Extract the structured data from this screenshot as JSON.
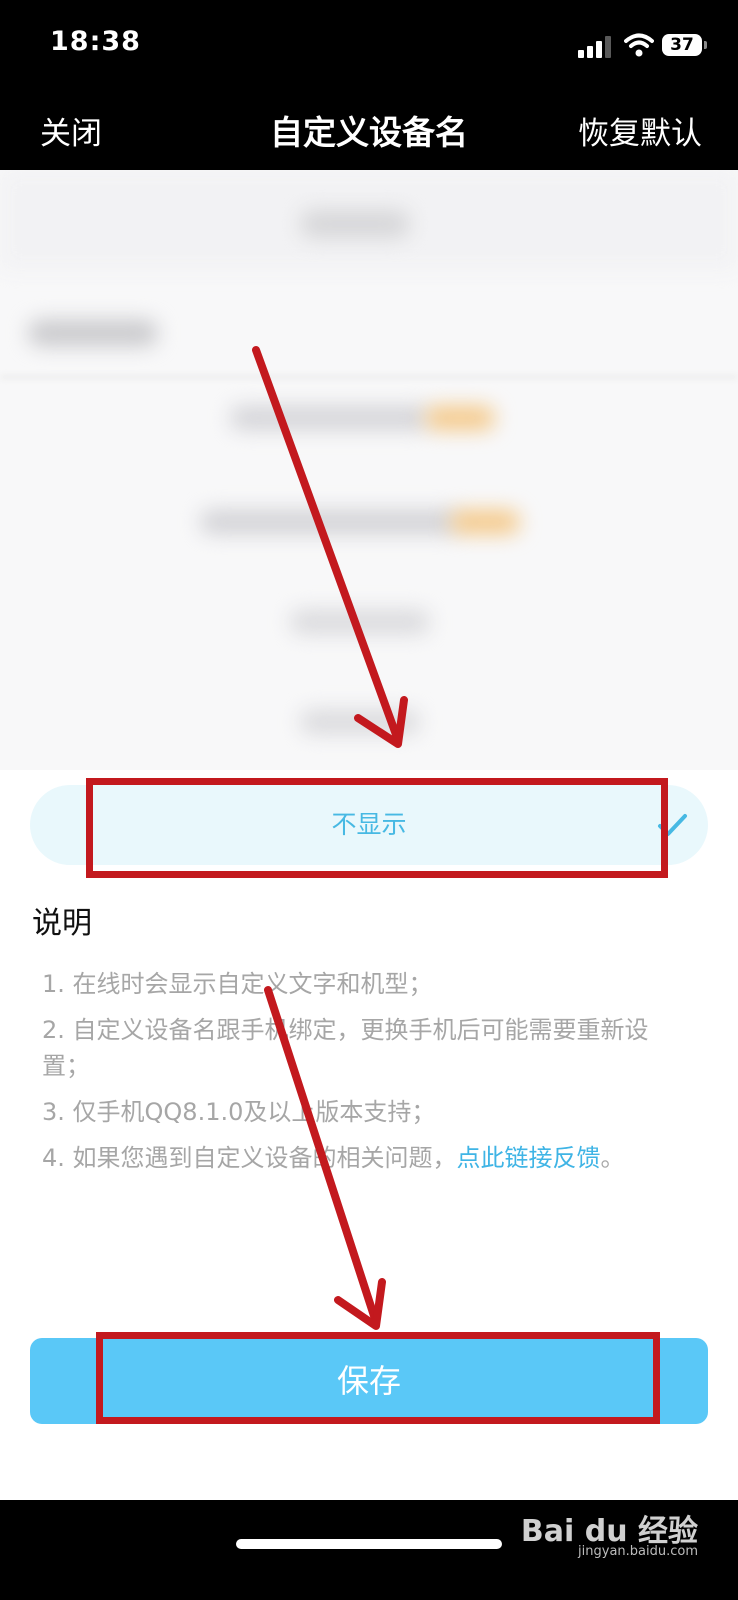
{
  "status_bar": {
    "time": "18:38",
    "battery": "37"
  },
  "nav": {
    "close": "关闭",
    "title": "自定义设备名",
    "restore": "恢复默认"
  },
  "option": {
    "label": "不显示",
    "selected": true
  },
  "description": {
    "title": "说明",
    "items": [
      "1. 在线时会显示自定义文字和机型；",
      "2. 自定义设备名跟手机绑定，更换手机后可能需要重新设置；",
      "3. 仅手机QQ8.1.0及以上版本支持；",
      "4. 如果您遇到自定义设备的相关问题，"
    ],
    "link_text": "点此链接反馈",
    "link_suffix": "。"
  },
  "save_button": "保存",
  "watermark": {
    "logo": "Bai du 经验",
    "url": "jingyan.baidu.com"
  },
  "colors": {
    "accent": "#5ac8f7",
    "link": "#3fb4e5",
    "annotation_red": "#c3191e"
  }
}
